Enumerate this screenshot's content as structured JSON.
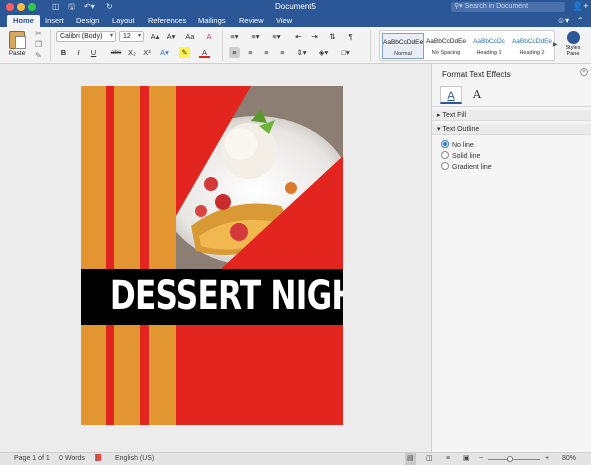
{
  "window": {
    "title": "Document5",
    "search_placeholder": "Search in Document"
  },
  "quick_access": {
    "sidebar_icon": "sidebar-icon",
    "save_icon": "save-icon",
    "undo_icon": "undo-icon",
    "redo_icon": "redo-icon"
  },
  "tabs": [
    "Home",
    "Insert",
    "Design",
    "Layout",
    "References",
    "Mailings",
    "Review",
    "View"
  ],
  "active_tab": "Home",
  "ribbon": {
    "paste_label": "Paste",
    "font_name": "Calibri (Body)",
    "font_size": "12",
    "grow_font": "A▴",
    "shrink_font": "A▾",
    "change_case": "Aa",
    "clear_format": "A",
    "bold": "B",
    "italic": "I",
    "underline": "U",
    "strike": "abc",
    "subscript": "X₂",
    "superscript": "X²",
    "styles": [
      {
        "sample": "AaBbCcDdEe",
        "name": "Normal",
        "color": "#222222"
      },
      {
        "sample": "AaBbCcDdEe",
        "name": "No Spacing",
        "color": "#222222"
      },
      {
        "sample": "AaBbCcDc",
        "name": "Heading 1",
        "color": "#2e74b5"
      },
      {
        "sample": "AaBbCcDdEe",
        "name": "Heading 2",
        "color": "#2e74b5"
      }
    ],
    "styles_pane_label": "Styles Pane"
  },
  "document": {
    "headline": "DESSERT NIGHT",
    "colors": {
      "red": "#e2251f",
      "orange": "#e29530",
      "cream": "#f0dcc0",
      "black": "#000000"
    }
  },
  "format_panel": {
    "title": "Format Text Effects",
    "tab_fill": "A",
    "tab_outline": "A",
    "section_fill": "Text Fill",
    "section_outline": "Text Outline",
    "options": [
      "No line",
      "Solid line",
      "Gradient line"
    ],
    "selected_option": "No line"
  },
  "status": {
    "page": "Page 1 of 1",
    "words": "0 Words",
    "language": "English (US)",
    "zoom": "80%",
    "zoom_level": 0.42
  }
}
